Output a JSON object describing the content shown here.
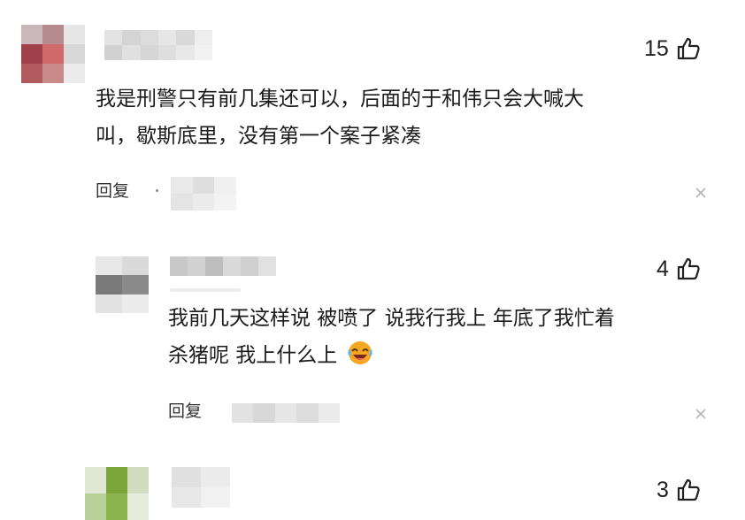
{
  "comments": [
    {
      "likes": "15",
      "text_lines": [
        "我是刑警只有前几集还可以，后面的于和伟只会大喊大",
        "叫，歇斯底里，没有第一个案子紧凑"
      ],
      "reply_label": "回复"
    },
    {
      "likes": "4",
      "text_lines": [
        "我前几天这样说 被喷了 说我行我上 年底了我忙着",
        "杀猪呢 我上什么上"
      ],
      "emoji": "laughing-crying-emoji",
      "reply_label": "回复"
    },
    {
      "likes": "3"
    }
  ],
  "icons": {
    "like": "thumbs-up-icon",
    "close": "close-icon"
  },
  "colors": {
    "avatar1_accent": "#a0404a",
    "avatar3_accent": "#7aa63a",
    "emoji_face": "#f5a623"
  }
}
